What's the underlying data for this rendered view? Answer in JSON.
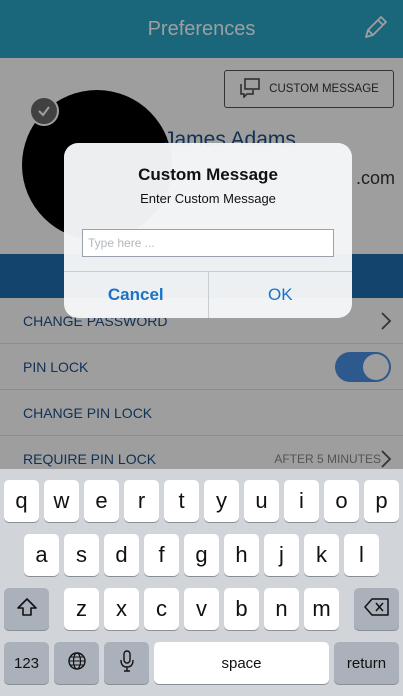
{
  "navbar": {
    "title": "Preferences",
    "edit_icon": "pencil-icon",
    "bg_color": "#2aa6c8"
  },
  "profile": {
    "custom_message_button": "CUSTOM MESSAGE",
    "name": "James Adams",
    "email_suffix": ".com"
  },
  "settings": [
    {
      "label": "CHANGE PASSWORD",
      "accessory": "chevron"
    },
    {
      "label": "PIN LOCK",
      "accessory": "toggle",
      "toggle_on": true
    },
    {
      "label": "CHANGE PIN LOCK",
      "accessory": "none"
    },
    {
      "label": "REQUIRE PIN LOCK",
      "accessory": "value-chevron",
      "value": "AFTER 5 MINUTES"
    }
  ],
  "alert": {
    "title": "Custom Message",
    "message": "Enter Custom Message",
    "input_placeholder": "Type here ...",
    "input_value": "",
    "cancel_label": "Cancel",
    "ok_label": "OK"
  },
  "keyboard": {
    "row1": [
      "q",
      "w",
      "e",
      "r",
      "t",
      "y",
      "u",
      "i",
      "o",
      "p"
    ],
    "row2": [
      "a",
      "s",
      "d",
      "f",
      "g",
      "h",
      "j",
      "k",
      "l"
    ],
    "row3": [
      "z",
      "x",
      "c",
      "v",
      "b",
      "n",
      "m"
    ],
    "numbers_label": "123",
    "space_label": "space",
    "return_label": "return",
    "icons": [
      "shift-icon",
      "backspace-icon",
      "globe-icon",
      "microphone-icon"
    ]
  },
  "colors": {
    "accent": "#1a73c5",
    "band": "#1d6fb0",
    "toggle": "#4a90e2"
  }
}
